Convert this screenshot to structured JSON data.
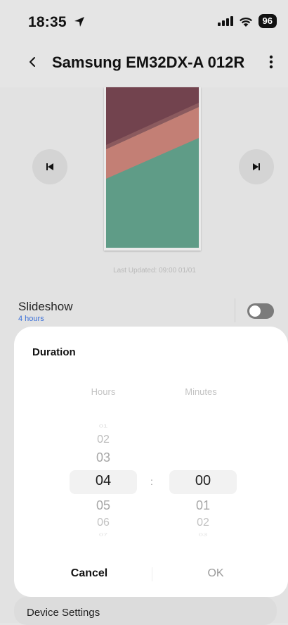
{
  "status_bar": {
    "time": "18:35",
    "battery": "96"
  },
  "header": {
    "title": "Samsung EM32DX-A 012R"
  },
  "preview": {
    "last_updated": "Last Updated: 09:00 01/01"
  },
  "slideshow": {
    "label": "Slideshow",
    "value": "4 hours",
    "enabled": false
  },
  "duration_sheet": {
    "title": "Duration",
    "hours_label": "Hours",
    "minutes_label": "Minutes",
    "colon": ":",
    "hours": [
      "01",
      "02",
      "03",
      "04",
      "05",
      "06",
      "07"
    ],
    "minutes": [
      "00",
      "01",
      "02",
      "03"
    ],
    "selected_hours": "04",
    "selected_minutes": "00",
    "cancel_label": "Cancel",
    "ok_label": "OK"
  },
  "footer": {
    "device_settings": "Device Settings"
  },
  "colors": {
    "accent_link": "#3a6fd8",
    "toggle_off": "#7b7b7b",
    "sheet_bg": "#ffffff"
  }
}
